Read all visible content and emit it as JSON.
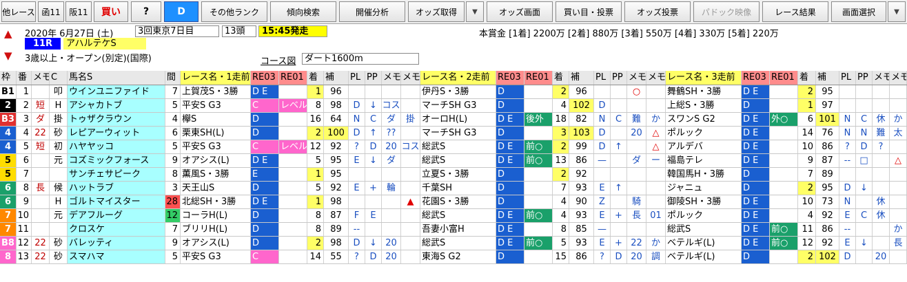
{
  "toolbar": {
    "buttons": [
      "他レース",
      "函11",
      "阪11",
      "買い",
      "?",
      "D",
      "その他ランク",
      "傾向検索",
      "開催分析",
      "オッズ取得",
      "▼",
      "オッズ画面",
      "買い目・投票",
      "オッズ投票",
      "パドック映像",
      "レース結果",
      "画面選択",
      "▼"
    ]
  },
  "race": {
    "date": "2020年 6月27日 (土)",
    "meeting": "3回東京7日目",
    "heads": "13頭",
    "start": "15:45発走",
    "num": "11R",
    "name": "アハルテケS",
    "cond": "3歳以上・オープン(別定)(国際)",
    "course_label": "コース図",
    "course": "ダート1600m",
    "prize": "本賞金 [1着] 2200万 [2着] 880万 [3着] 550万 [4着] 330万 [5着] 220万"
  },
  "headers": [
    "枠",
    "番",
    "メモ",
    "C",
    "馬名S",
    "間",
    "レース名・1走前",
    "RE03",
    "RE01",
    "着",
    "補",
    "PL",
    "PP",
    "メモ",
    "メモ",
    "レース名・2走前",
    "RE03",
    "RE01",
    "着",
    "補",
    "PL",
    "PP",
    "メモ",
    "メモ",
    "レース名・3走前",
    "RE03",
    "RE01",
    "着",
    "補",
    "PL",
    "PP",
    "メモ",
    "メモ"
  ],
  "rows": [
    {
      "w": "B1",
      "n": "1",
      "m": "",
      "c": "叩",
      "h": "ウインユニファイド",
      "i": "7",
      "r1": "上賀茂S・3勝",
      "a1": "D E",
      "b1": "",
      "f1": "1",
      "s1": "96",
      "pl1": "",
      "pp1": "",
      "x1": "",
      "y1": "",
      "r2": "伊丹S・3勝",
      "a2": "D",
      "b2": "",
      "f2": "2",
      "s2": "96",
      "pl2": "",
      "pp2": "",
      "x2": "○",
      "y2": "",
      "r3": "舞鶴SH・3勝",
      "a3": "D E",
      "b3": "",
      "f3": "2",
      "s3": "95",
      "pl3": "",
      "pp3": "",
      "x3": "",
      "y3": ""
    },
    {
      "w": "2",
      "n": "2",
      "m": "短",
      "c": "H",
      "h": "アシャカトブ",
      "i": "5",
      "r1": "平安S G3",
      "a1": "C",
      "b1": "レベル",
      "f1": "8",
      "s1": "98",
      "pl1": "D",
      "pp1": "↓",
      "x1": "コス",
      "y1": "",
      "r2": "マーチSH G3",
      "a2": "D",
      "b2": "",
      "f2": "4",
      "s2": "102",
      "pl2": "D",
      "pp2": "",
      "x2": "",
      "y2": "",
      "r3": "上総S・3勝",
      "a3": "D",
      "b3": "",
      "f3": "1",
      "s3": "97",
      "pl3": "",
      "pp3": "",
      "x3": "",
      "y3": ""
    },
    {
      "w": "B3",
      "n": "3",
      "m": "ダ",
      "c": "掛",
      "h": "トゥザクラウン",
      "i": "4",
      "r1": "欅S",
      "a1": "D",
      "b1": "",
      "f1": "16",
      "s1": "64",
      "pl1": "N",
      "pp1": "C",
      "x1": "ダ",
      "y1": "掛",
      "r2": "オーロH(L)",
      "a2": "D E",
      "b2": "後外",
      "f2": "18",
      "s2": "82",
      "pl2": "N",
      "pp2": "C",
      "x2": "難",
      "y2": "か",
      "r3": "スワンS G2",
      "a3": "D E",
      "b3": "外○",
      "f3": "6",
      "s3": "101",
      "pl3": "N",
      "pp3": "C",
      "x3": "休",
      "y3": "か"
    },
    {
      "w": "4",
      "n": "4",
      "m": "22",
      "c": "砂",
      "h": "レピアーウィット",
      "i": "6",
      "r1": "栗東SH(L)",
      "a1": "D",
      "b1": "",
      "f1": "2",
      "s1": "100",
      "pl1": "D",
      "pp1": "↑",
      "x1": "??",
      "y1": "",
      "r2": "マーチSH G3",
      "a2": "D",
      "b2": "",
      "f2": "3",
      "s2": "103",
      "pl2": "D",
      "pp2": "",
      "x2": "20",
      "y2": "△",
      "r3": "ポルック",
      "a3": "D E",
      "b3": "",
      "f3": "14",
      "s3": "76",
      "pl3": "N",
      "pp3": "N",
      "x3": "難",
      "y3": "太"
    },
    {
      "w": "4",
      "n": "5",
      "m": "短",
      "c": "初",
      "h": "ハヤヤッコ",
      "i": "5",
      "r1": "平安S G3",
      "a1": "C",
      "b1": "レベル",
      "f1": "12",
      "s1": "92",
      "pl1": "?",
      "pp1": "D",
      "x1": "20",
      "y1": "コス",
      "r2": "総武S",
      "a2": "D E",
      "b2": "前○",
      "f2": "2",
      "s2": "99",
      "pl2": "D",
      "pp2": "↑",
      "x2": "",
      "y2": "△",
      "r3": "アルデバ",
      "a3": "D E",
      "b3": "",
      "f3": "10",
      "s3": "86",
      "pl3": "?",
      "pp3": "D",
      "x3": "?",
      "y3": ""
    },
    {
      "w": "5",
      "n": "6",
      "m": "",
      "c": "元",
      "h": "コズミックフォース",
      "i": "9",
      "r1": "オアシス(L)",
      "a1": "D E",
      "b1": "",
      "f1": "5",
      "s1": "95",
      "pl1": "E",
      "pp1": "↓",
      "x1": "ダ",
      "y1": "",
      "r2": "総武S",
      "a2": "D E",
      "b2": "前○",
      "f2": "13",
      "s2": "86",
      "pl2": "—",
      "pp2": "",
      "x2": "ダ",
      "y2": "ー",
      "r3": "福島テレ",
      "a3": "D E",
      "b3": "",
      "f3": "9",
      "s3": "87",
      "pl3": "--",
      "pp3": "□",
      "x3": "",
      "y3": "△"
    },
    {
      "w": "5",
      "n": "7",
      "m": "",
      "c": "",
      "h": "サンチェサピーク",
      "i": "8",
      "r1": "薫風S・3勝",
      "a1": "E",
      "b1": "",
      "f1": "1",
      "s1": "95",
      "pl1": "",
      "pp1": "",
      "x1": "",
      "y1": "",
      "r2": "立夏S・3勝",
      "a2": "D",
      "b2": "",
      "f2": "2",
      "s2": "92",
      "pl2": "",
      "pp2": "",
      "x2": "",
      "y2": "",
      "r3": "韓国馬H・3勝",
      "a3": "D",
      "b3": "",
      "f3": "7",
      "s3": "89",
      "pl3": "",
      "pp3": "",
      "x3": "",
      "y3": ""
    },
    {
      "w": "6",
      "n": "8",
      "m": "長",
      "c": "候",
      "h": "ハットラブ",
      "i": "3",
      "r1": "天王山S",
      "a1": "D",
      "b1": "",
      "f1": "5",
      "s1": "92",
      "pl1": "E",
      "pp1": "+",
      "x1": "輪",
      "y1": "",
      "r2": "千葉SH",
      "a2": "D",
      "b2": "",
      "f2": "7",
      "s2": "93",
      "pl2": "E",
      "pp2": "↑",
      "x2": "",
      "y2": "",
      "r3": "ジャニュ",
      "a3": "D",
      "b3": "",
      "f3": "2",
      "s3": "95",
      "pl3": "D",
      "pp3": "↓",
      "x3": "",
      "y3": ""
    },
    {
      "w": "6",
      "n": "9",
      "m": "",
      "c": "H",
      "h": "ゴルトマイスター",
      "i": "28",
      "r1": "北総SH・3勝",
      "a1": "D E",
      "b1": "",
      "f1": "1",
      "s1": "98",
      "pl1": "",
      "pp1": "",
      "x1": "",
      "y1": "▲",
      "r2": "花園S・3勝",
      "a2": "D",
      "b2": "",
      "f2": "4",
      "s2": "90",
      "pl2": "Z",
      "pp2": "",
      "x2": "騎",
      "y2": "",
      "r3": "御陵SH・3勝",
      "a3": "D E",
      "b3": "",
      "f3": "10",
      "s3": "73",
      "pl3": "N",
      "pp3": "",
      "x3": "休",
      "y3": ""
    },
    {
      "w": "7",
      "n": "10",
      "m": "",
      "c": "元",
      "h": "デアフルーグ",
      "i": "12",
      "r1": "コーラH(L)",
      "a1": "D",
      "b1": "",
      "f1": "8",
      "s1": "87",
      "pl1": "F",
      "pp1": "E",
      "x1": "",
      "y1": "",
      "r2": "総武S",
      "a2": "D E",
      "b2": "前○",
      "f2": "4",
      "s2": "93",
      "pl2": "E",
      "pp2": "+",
      "x2": "長",
      "y2": "01",
      "r3": "ポルック",
      "a3": "D E",
      "b3": "",
      "f3": "4",
      "s3": "92",
      "pl3": "E",
      "pp3": "C",
      "x3": "休",
      "y3": ""
    },
    {
      "w": "7",
      "n": "11",
      "m": "",
      "c": "",
      "h": "クロスケ",
      "i": "7",
      "r1": "ブリリH(L)",
      "a1": "D",
      "b1": "",
      "f1": "8",
      "s1": "89",
      "pl1": "--",
      "pp1": "",
      "x1": "",
      "y1": "",
      "r2": "吾妻小富H",
      "a2": "D E",
      "b2": "",
      "f2": "8",
      "s2": "85",
      "pl2": "—",
      "pp2": "",
      "x2": "",
      "y2": "",
      "r3": "総武S",
      "a3": "D E",
      "b3": "前○",
      "f3": "11",
      "s3": "86",
      "pl3": "--",
      "pp3": "",
      "x3": "",
      "y3": "か"
    },
    {
      "w": "B8",
      "n": "12",
      "m": "22",
      "c": "砂",
      "h": "バレッティ",
      "i": "9",
      "r1": "オアシス(L)",
      "a1": "D",
      "b1": "",
      "f1": "2",
      "s1": "98",
      "pl1": "D",
      "pp1": "↓",
      "x1": "20",
      "y1": "",
      "r2": "総武S",
      "a2": "D E",
      "b2": "前○",
      "f2": "5",
      "s2": "93",
      "pl2": "E",
      "pp2": "+",
      "x2": "22",
      "y2": "か",
      "r3": "ベテルギ(L)",
      "a3": "D E",
      "b3": "前○",
      "f3": "12",
      "s3": "92",
      "pl3": "E",
      "pp3": "↓",
      "x3": "",
      "y3": "長"
    },
    {
      "w": "8",
      "n": "13",
      "m": "22",
      "c": "砂",
      "h": "スマハマ",
      "i": "5",
      "r1": "平安S G3",
      "a1": "C",
      "b1": "",
      "f1": "14",
      "s1": "55",
      "pl1": "?",
      "pp1": "D",
      "x1": "20",
      "y1": "",
      "r2": "東海S G2",
      "a2": "D",
      "b2": "",
      "f2": "15",
      "s2": "86",
      "pl2": "?",
      "pp2": "D",
      "x2": "20",
      "y2": "調",
      "r3": "ベテルギ(L)",
      "a3": "D",
      "b3": "",
      "f3": "2",
      "s3": "102",
      "pl3": "D",
      "pp3": "",
      "x3": "20",
      "y3": ""
    }
  ]
}
